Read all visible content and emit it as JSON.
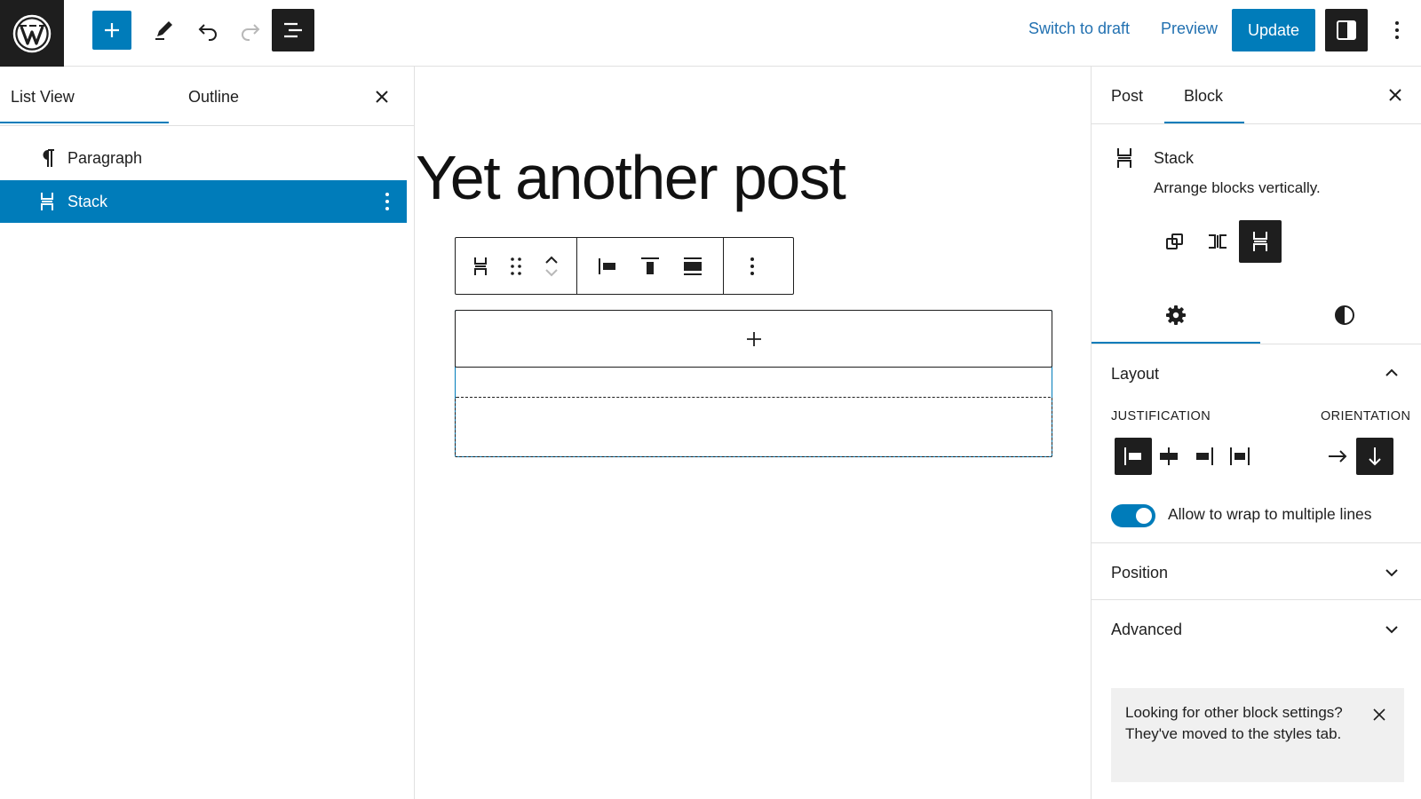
{
  "header": {
    "switch_to_draft": "Switch to draft",
    "preview": "Preview",
    "update": "Update"
  },
  "left_panel": {
    "tabs": [
      {
        "label": "List View",
        "active": true
      },
      {
        "label": "Outline",
        "active": false
      }
    ],
    "items": [
      {
        "label": "Paragraph",
        "icon": "paragraph-icon",
        "selected": false
      },
      {
        "label": "Stack",
        "icon": "stack-icon",
        "selected": true
      }
    ]
  },
  "editor": {
    "post_title": "Yet another post"
  },
  "right_panel": {
    "tabs": [
      {
        "label": "Post",
        "active": false
      },
      {
        "label": "Block",
        "active": true
      }
    ],
    "block_card": {
      "title": "Stack",
      "description": "Arrange blocks vertically."
    },
    "layout": {
      "title": "Layout",
      "justification_label": "JUSTIFICATION",
      "orientation_label": "ORIENTATION",
      "wrap_label": "Allow to wrap to multiple lines",
      "wrap_enabled": true
    },
    "position_title": "Position",
    "advanced_title": "Advanced",
    "notice": "Looking for other block settings? They've moved to the styles tab."
  },
  "colors": {
    "accent": "#007cba",
    "dark": "#1e1e1e"
  }
}
